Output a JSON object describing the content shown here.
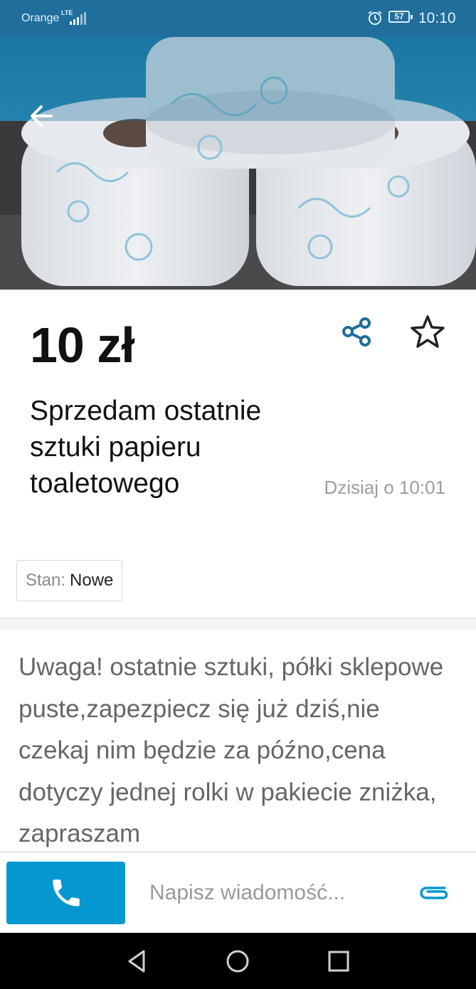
{
  "status_bar": {
    "carrier": "Orange",
    "network": "LTE",
    "battery": "57",
    "time": "10:10"
  },
  "listing": {
    "price": "10 zł",
    "title": "Sprzedam ostatnie sztuki papieru toaletowego",
    "date": "Dzisiaj o 10:01",
    "condition_label": "Stan:",
    "condition_value": "Nowe",
    "description": "Uwaga! ostatnie sztuki, półki sklepowe puste,zapezpiecz się już dziś,nie czekaj nim będzie za późno,cena dotyczy jednej rolki w pakiecie zniżka, zapraszam"
  },
  "message": {
    "placeholder": "Napisz wiadomość..."
  },
  "colors": {
    "status_bar": "#1f6e9c",
    "accent": "#0597cf",
    "price_text": "#111111",
    "muted_text": "#9e9e9e"
  },
  "icons": [
    "back-arrow-icon",
    "share-icon",
    "star-icon",
    "phone-icon",
    "paperclip-icon",
    "nav-back-icon",
    "nav-home-icon",
    "nav-recents-icon"
  ]
}
